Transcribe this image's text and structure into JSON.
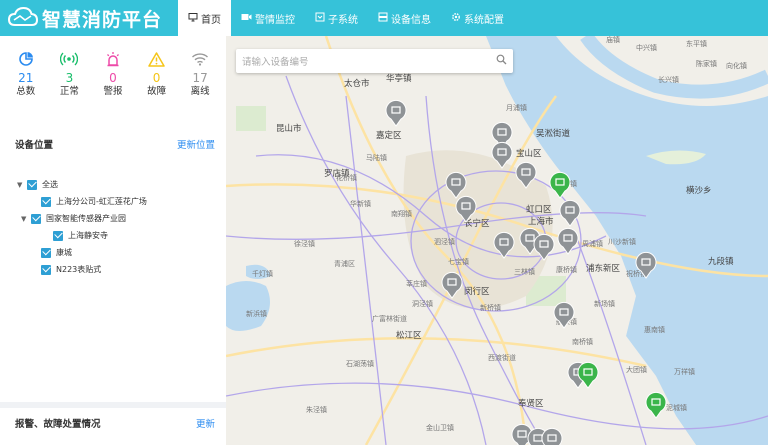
{
  "brand": {
    "title": "智慧消防平台"
  },
  "nav": [
    {
      "label": "首页",
      "icon": "monitor-icon",
      "active": true
    },
    {
      "label": "警情监控",
      "icon": "video-icon"
    },
    {
      "label": "子系统",
      "icon": "grid-icon"
    },
    {
      "label": "设备信息",
      "icon": "server-icon"
    },
    {
      "label": "系统配置",
      "icon": "gear-icon"
    }
  ],
  "search": {
    "placeholder": "请输入设备编号"
  },
  "stats": [
    {
      "value": "21",
      "label": "总数",
      "color": "#2c8cf0",
      "icon": "pie-icon"
    },
    {
      "value": "3",
      "label": "正常",
      "color": "#19be6b",
      "icon": "signal-icon"
    },
    {
      "value": "0",
      "label": "警报",
      "color": "#ed4aa8",
      "icon": "alarm-icon"
    },
    {
      "value": "0",
      "label": "故障",
      "color": "#f5c518",
      "icon": "warning-icon"
    },
    {
      "value": "17",
      "label": "离线",
      "color": "#999999",
      "icon": "wifi-icon"
    }
  ],
  "device_section": {
    "title": "设备位置",
    "action": "更新位置"
  },
  "tree": [
    {
      "label": "全选",
      "level": 0,
      "caret": true
    },
    {
      "label": "上海分公司-虹汇莲花广场",
      "level": 1,
      "caret": false
    },
    {
      "label": "国家智能传感器产业园",
      "level": 1,
      "caret": true
    },
    {
      "label": "上海静安寺",
      "level": 2,
      "caret": false
    },
    {
      "label": "康城",
      "level": 1,
      "caret": false
    },
    {
      "label": "N223表贴式",
      "level": 1,
      "caret": false
    }
  ],
  "alarm_section": {
    "title": "报警、故障处置情况",
    "action": "更新"
  },
  "map": {
    "labels": [
      "太仓市",
      "华亭镇",
      "嘉定区",
      "昆山市",
      "宝山区",
      "罗店镇",
      "吴淞街道",
      "虹口区",
      "上海市",
      "长宁区",
      "闵行区",
      "松江区",
      "奉贤区",
      "浦东新区",
      "九段镇",
      "横沙乡",
      "千灯镇",
      "南翔镇",
      "花桥镇",
      "七宝镇",
      "青浦区",
      "广富林街道",
      "泗泾镇",
      "新浜镇",
      "西渡街道",
      "南桥镇",
      "航头镇",
      "祝桥镇",
      "惠南镇",
      "泥城镇",
      "万祥镇",
      "大团镇",
      "新场镇",
      "朱泾镇",
      "石湖荡镇",
      "金山卫镇",
      "周浦镇",
      "川沙新镇",
      "高桥镇",
      "中兴镇",
      "长兴镇",
      "月浦镇",
      "陈家镇",
      "向化镇",
      "马陆镇",
      "徐泾镇",
      "华新镇",
      "莘庄镇",
      "三林镇",
      "康桥镇",
      "庙镇",
      "东平镇",
      "洞泾镇",
      "新桥镇"
    ]
  }
}
